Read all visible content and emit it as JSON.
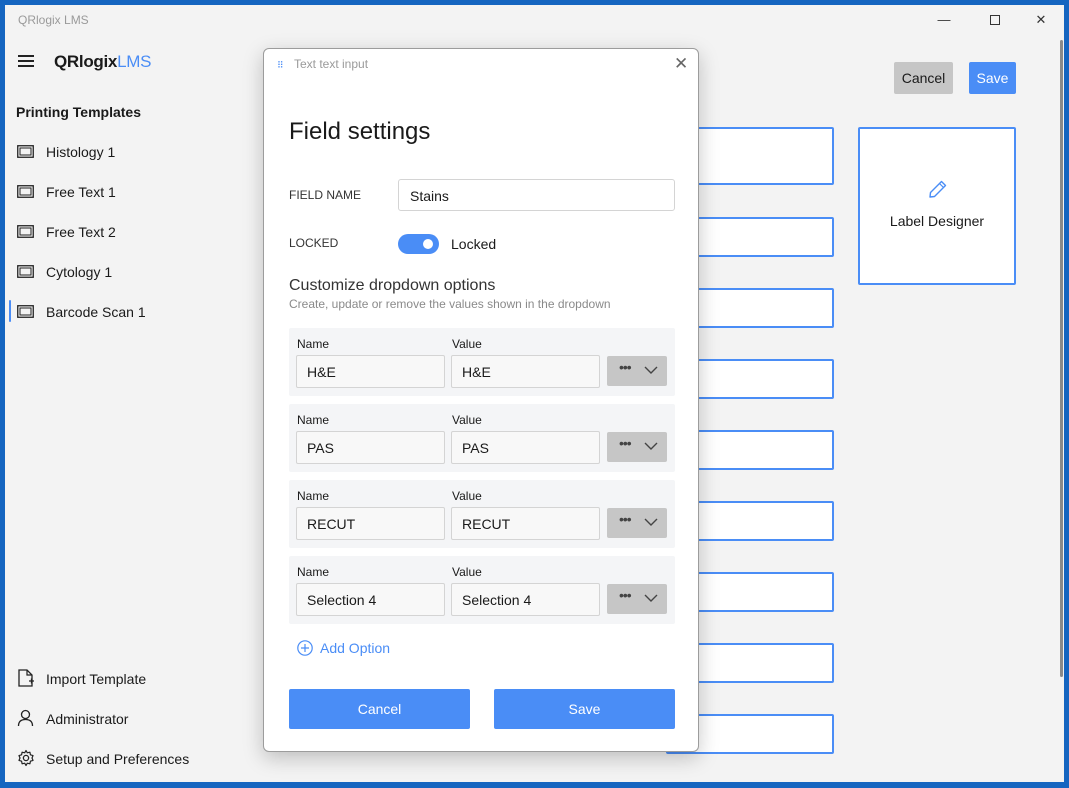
{
  "window": {
    "title": "QRlogix LMS",
    "minimize": "—",
    "close": "✕"
  },
  "sidebar": {
    "brand_main": "QRlogix",
    "brand_accent": "LMS",
    "section_title": "Printing Templates",
    "templates": [
      {
        "label": "Histology 1",
        "icon": "template-icon"
      },
      {
        "label": "Free Text 1",
        "icon": "template-icon"
      },
      {
        "label": "Free Text 2",
        "icon": "template-icon"
      },
      {
        "label": "Cytology 1",
        "icon": "template-icon"
      },
      {
        "label": "Barcode Scan 1",
        "icon": "template-icon",
        "selected": true
      }
    ],
    "bottom": [
      {
        "label": "Import Template",
        "icon": "import-file-icon"
      },
      {
        "label": "Administrator",
        "icon": "user-icon"
      },
      {
        "label": "Setup and Preferences",
        "icon": "gear-icon"
      }
    ]
  },
  "main": {
    "cancel_label": "Cancel",
    "save_label": "Save",
    "label_designer": "Label Designer"
  },
  "dialog": {
    "title": "Text text input",
    "close": "✕",
    "heading": "Field settings",
    "field_name_label": "FIELD NAME",
    "field_name_value": "Stains",
    "locked_label": "LOCKED",
    "locked_state_text": "Locked",
    "locked": true,
    "customize_title": "Customize dropdown options",
    "customize_subtitle": "Create, update or remove the values shown in the dropdown",
    "name_caption": "Name",
    "value_caption": "Value",
    "options": [
      {
        "name": "H&E",
        "value": "H&E"
      },
      {
        "name": "PAS",
        "value": "PAS"
      },
      {
        "name": "RECUT",
        "value": "RECUT"
      },
      {
        "name": "Selection 4",
        "value": "Selection 4"
      }
    ],
    "more_glyph": "•••",
    "add_option_label": "Add Option",
    "cancel_label": "Cancel",
    "save_label": "Save"
  },
  "colors": {
    "accent": "#4a8df6",
    "window_border": "#1565c0",
    "button_gray": "#c6c6c6"
  }
}
